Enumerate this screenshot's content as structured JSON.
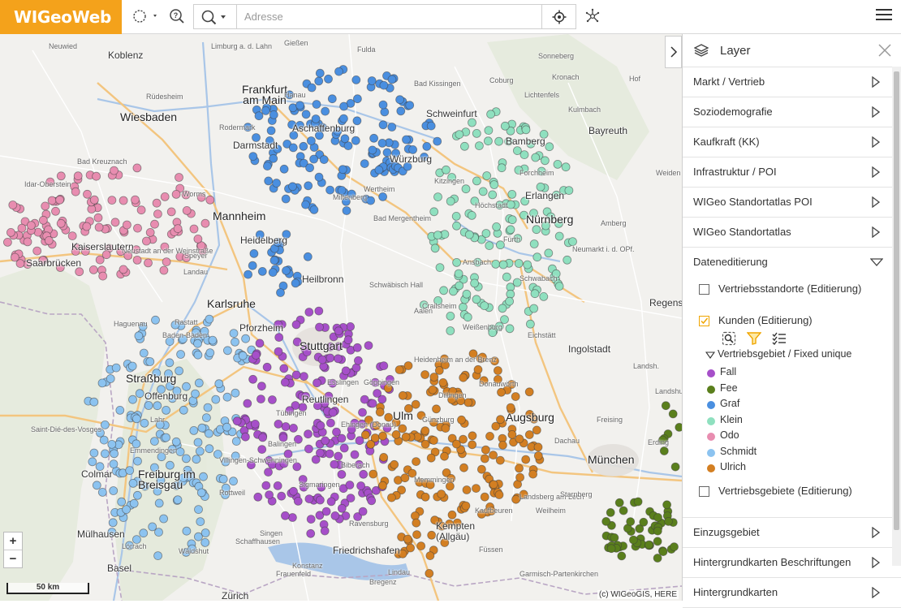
{
  "app": {
    "logo": "WIGeoWeb"
  },
  "search": {
    "placeholder": "Adresse"
  },
  "map": {
    "attribution": "(c) WIGeoGIS, HERE",
    "scale_label": "50 km",
    "zoom_in": "+",
    "zoom_out": "−",
    "cities": [
      {
        "name": "Wiesbaden",
        "big": true
      },
      {
        "name": "Frankfurt\nam Main",
        "big": true
      },
      {
        "name": "Darmstadt",
        "big": false
      },
      {
        "name": "Mannheim",
        "big": true
      },
      {
        "name": "Heidelberg",
        "big": false
      },
      {
        "name": "Karlsruhe",
        "big": true
      },
      {
        "name": "Pforzheim",
        "big": false
      },
      {
        "name": "Stuttgart",
        "big": true
      },
      {
        "name": "Straßburg",
        "big": true
      },
      {
        "name": "Freiburg im\nBreisgau",
        "big": true
      },
      {
        "name": "Nürnberg",
        "big": true
      },
      {
        "name": "Erlangen",
        "big": false
      },
      {
        "name": "Bamberg",
        "big": false
      },
      {
        "name": "Augsburg",
        "big": true
      },
      {
        "name": "München",
        "big": true
      },
      {
        "name": "Ingolstadt",
        "big": false
      },
      {
        "name": "Würzburg",
        "big": false
      },
      {
        "name": "Bayreuth",
        "big": false
      },
      {
        "name": "Koblenz",
        "big": false
      },
      {
        "name": "Kaiserslautern",
        "big": false
      },
      {
        "name": "Saarbrücken",
        "big": false
      },
      {
        "name": "Heilbronn",
        "big": false
      },
      {
        "name": "Ulm",
        "big": true
      },
      {
        "name": "Basel",
        "big": false
      },
      {
        "name": "Zürich",
        "big": false
      },
      {
        "name": "Kempten\n(Allgäu)",
        "big": false
      },
      {
        "name": "Friedrichshafen",
        "big": false
      },
      {
        "name": "Colmar",
        "big": false
      },
      {
        "name": "Mülhausen",
        "big": false
      },
      {
        "name": "Regensburg",
        "big": false
      },
      {
        "name": "Offenburg",
        "big": false
      },
      {
        "name": "Reutlingen",
        "big": false
      },
      {
        "name": "Schweinfurt",
        "big": false
      },
      {
        "name": "Aschaffenburg",
        "big": false
      }
    ],
    "towns": [
      "Limburg a. d. Lahn",
      "Rüdesheim",
      "Neuwied",
      "Gießen",
      "Fulda",
      "Bad Kissingen",
      "Coburg",
      "Sonneberg",
      "Kronach",
      "Lichtenfels",
      "Kulmbach",
      "Hof",
      "Weiden i. d. OPf.",
      "Amberg",
      "Neumarkt i. d. OPf.",
      "Landshut",
      "Freising",
      "Erding",
      "Dachau",
      "Landsberg am Lech",
      "Memmingen",
      "Kaufbeuren",
      "Ravensburg",
      "Konstanz",
      "Lindau",
      "Sigmaringen",
      "Tübingen",
      "Esslingen",
      "Göppingen",
      "Aalen",
      "Heidenheim an der Brenz",
      "Crailsheim",
      "Ansbach",
      "Schwäbisch Hall",
      "Bad Mergentheim",
      "Worms",
      "Speyer",
      "Neustadt an der Weinstraße",
      "Landau",
      "Baden-Baden",
      "Rastatt",
      "Lahr",
      "Villingen-Schwenningen",
      "Waldshut",
      "Lörrach",
      "Schaffhausen",
      "Singen",
      "Saint-Dié-des-Vosges",
      "Haguenau",
      "Bad Kreuznach",
      "Idar-Oberstein",
      "Rodermark",
      "Hanau",
      "Miltenberg",
      "Wertheim",
      "Kitzingen",
      "Forchheim",
      "Höchstadt",
      "Fürth",
      "Schwabach",
      "Weißenburg",
      "Eichstätt",
      "Donauwörth",
      "Dillingen",
      "Günzburg",
      "Biberach",
      "Ehingen (Donau)",
      "Balingen",
      "Rottweil",
      "Emmendingen",
      "Frauenfeld",
      "Bregenz",
      "Füssen",
      "Garmisch-Partenkirchen",
      "Weilheim",
      "Starnberg",
      "Landsh."
    ]
  },
  "panel": {
    "title": "Layer",
    "sections": [
      {
        "label": "Markt / Vertrieb",
        "expanded": false
      },
      {
        "label": "Soziodemografie",
        "expanded": false
      },
      {
        "label": "Kaufkraft (KK)",
        "expanded": false
      },
      {
        "label": "Infrastruktur / POI",
        "expanded": false
      },
      {
        "label": "WIGeo Standortatlas POI",
        "expanded": false
      },
      {
        "label": "WIGeo Standortatlas",
        "expanded": false
      },
      {
        "label": "Dateneditierung",
        "expanded": true
      }
    ],
    "editing": {
      "layer1": {
        "label": "Vertriebsstandorte (Editierung)",
        "checked": false
      },
      "layer2": {
        "label": "Kunden (Editierung)",
        "checked": true
      },
      "legend_title": "Vertriebsgebiet / Fixed unique",
      "legend": [
        {
          "label": "Fall",
          "color": "#a64fc9"
        },
        {
          "label": "Fee",
          "color": "#5a7f1c"
        },
        {
          "label": "Graf",
          "color": "#4a8fe0"
        },
        {
          "label": "Klein",
          "color": "#8fe0bf"
        },
        {
          "label": "Odo",
          "color": "#e88db0"
        },
        {
          "label": "Schmidt",
          "color": "#8cc3f0"
        },
        {
          "label": "Ulrich",
          "color": "#d37f22"
        }
      ],
      "layer3": {
        "label": "Vertriebsgebiete (Editierung)",
        "checked": false
      }
    },
    "bottom_sections": [
      {
        "label": "Einzugsgebiet"
      },
      {
        "label": "Hintergrundkarten Beschriftungen"
      },
      {
        "label": "Hintergrundkarten"
      }
    ]
  },
  "colors": {
    "logo_bg": "#f4a21b",
    "checkbox_checked": "#f0a500",
    "filter_icon": "#f0a500"
  }
}
